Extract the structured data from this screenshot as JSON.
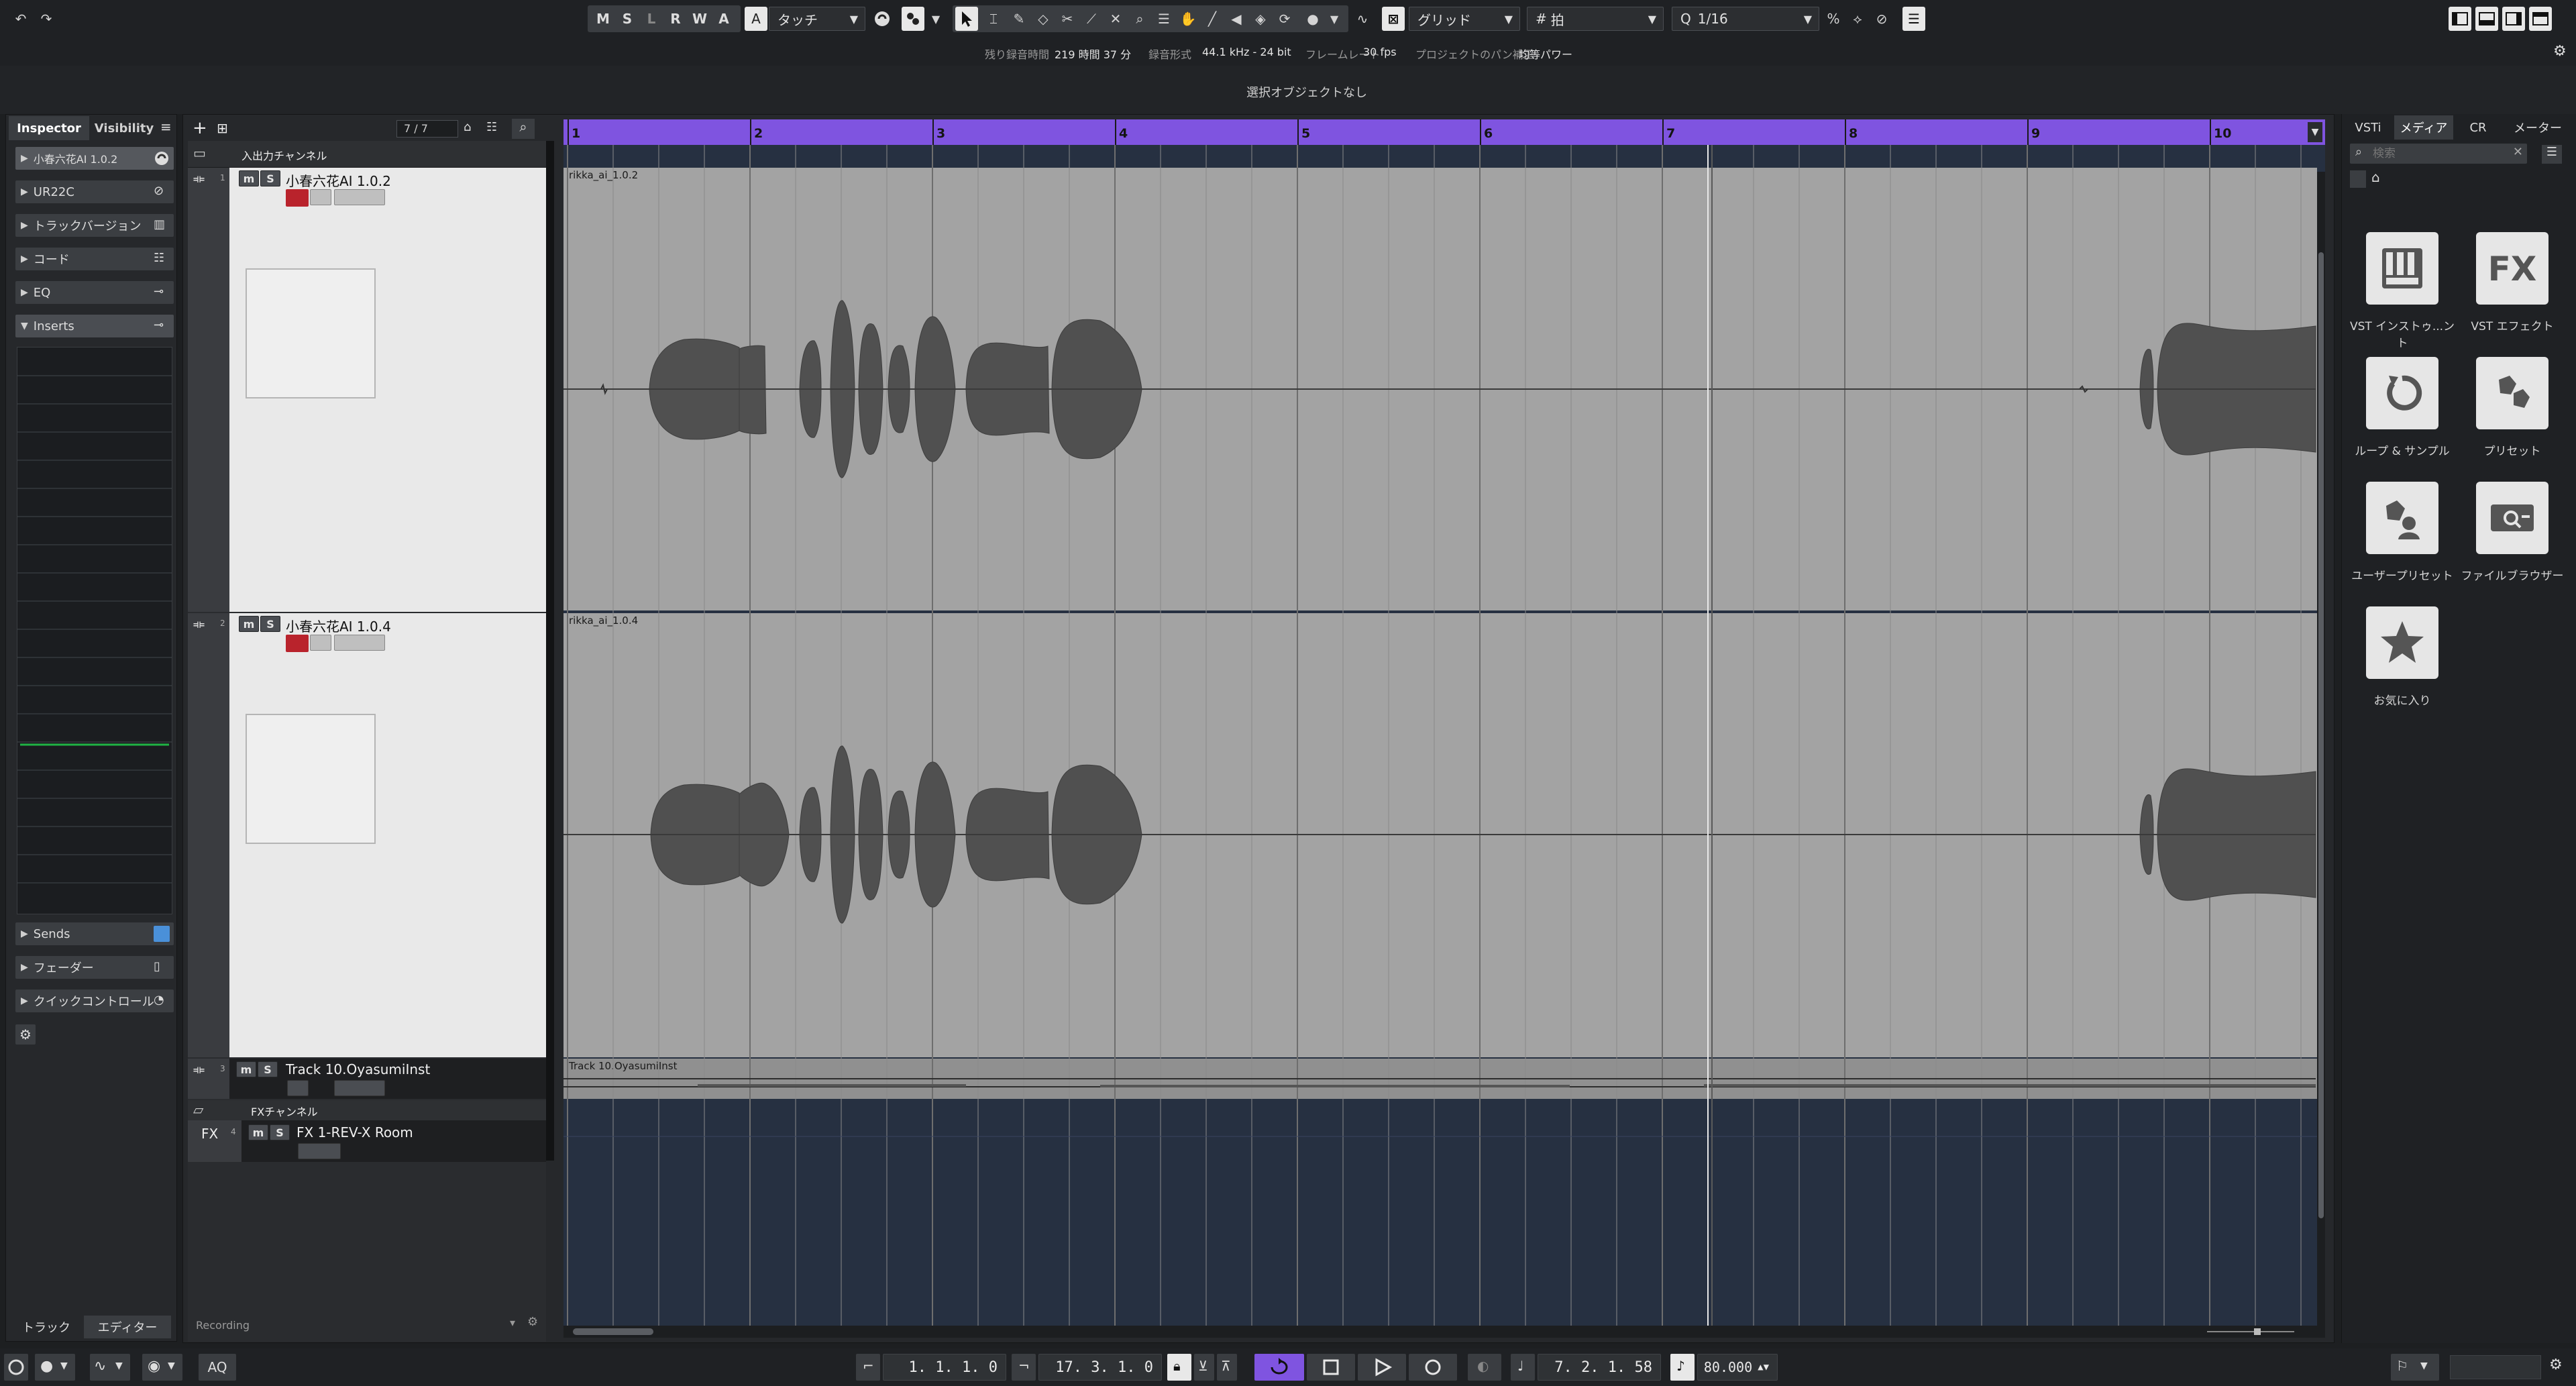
{
  "toolbar": {
    "modes": [
      "M",
      "S",
      "L",
      "R",
      "W",
      "A"
    ],
    "automation_mode": "タッチ",
    "snap_type": "グリッド",
    "grid_type": "拍",
    "quantize": "1/16"
  },
  "info": {
    "rec_time_label": "残り録音時間",
    "rec_time": "219 時間 37 分",
    "rec_format_label": "録音形式",
    "rec_format": "44.1 kHz - 24 bit",
    "frame_rate_label": "フレームレート",
    "frame_rate": "30 fps",
    "pan_label": "プロジェクトのパン補正",
    "pan_value": "均等パワー"
  },
  "selection_status": "選択オブジェクトなし",
  "inspector": {
    "tabs": [
      "Inspector",
      "Visibility"
    ],
    "track_name": "小春六花AI 1.0.2",
    "sections": [
      "UR22C",
      "トラックバージョン",
      "コード",
      "EQ",
      "Inserts"
    ],
    "bottom_sections": [
      "Sends",
      "フェーダー",
      "クイックコントロール"
    ],
    "footer_tabs": [
      "トラック",
      "エディター"
    ]
  },
  "project": {
    "track_count": "7 / 7",
    "folder_io": "入出力チャンネル",
    "tracks": [
      {
        "num": "1",
        "name": "小春六花AI 1.0.2",
        "event": "rikka_ai_1.0.2"
      },
      {
        "num": "2",
        "name": "小春六花AI 1.0.4",
        "event": "rikka_ai_1.0.4"
      },
      {
        "num": "3",
        "name": "Track 10.OyasumiInst",
        "event": "Track 10.OyasumiInst"
      }
    ],
    "folder_fx": "FXチャンネル",
    "fx_track": {
      "num": "4",
      "tag": "FX",
      "name": "FX 1-REV-X Room"
    },
    "footer_label": "Recording",
    "ruler_bars": [
      "1",
      "2",
      "3",
      "4",
      "5",
      "6",
      "7",
      "8",
      "9",
      "10"
    ]
  },
  "rightzone": {
    "tabs": [
      "VSTi",
      "メディア",
      "CR",
      "メーター"
    ],
    "search_placeholder": "検索",
    "tiles": [
      {
        "label": "VST インストゥ...ント",
        "icon": "piano-icon"
      },
      {
        "label": "VST エフェクト",
        "icon": "fx-icon"
      },
      {
        "label": "ループ & サンプル",
        "icon": "loop-icon"
      },
      {
        "label": "プリセット",
        "icon": "preset-icon"
      },
      {
        "label": "ユーザープリセット",
        "icon": "user-preset-icon"
      },
      {
        "label": "ファイルブラウザー",
        "icon": "file-browser-icon"
      },
      {
        "label": "お気に入り",
        "icon": "star-icon"
      }
    ],
    "fx_text": "FX"
  },
  "transport": {
    "left_locator": "1. 1. 1.   0",
    "right_locator": "17. 3. 1.   0",
    "position": "7. 2. 1.  58",
    "tempo": "80.000",
    "aq": "AQ"
  },
  "colors": {
    "ruler": "#7f54e0",
    "record": "#b9232c",
    "lane": "#a3a3a3",
    "waveform": "#505050",
    "arrange_bg": "#263041"
  }
}
